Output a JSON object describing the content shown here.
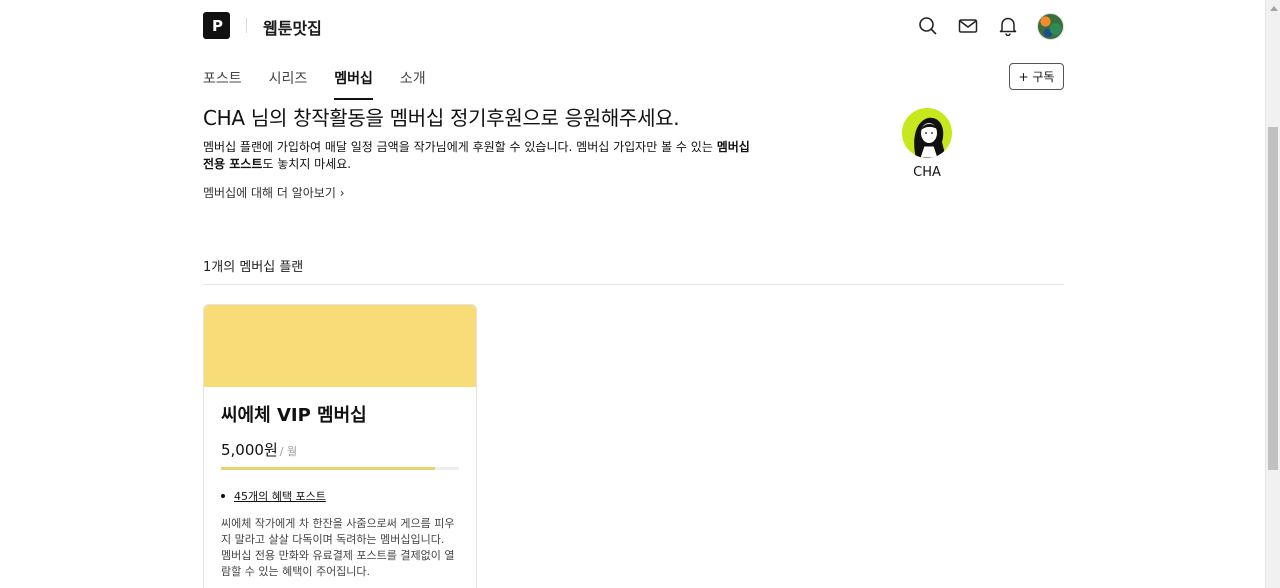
{
  "header": {
    "logo_text": "P",
    "blog_name": "웹툰맛집",
    "icons": [
      "search-icon",
      "mail-icon",
      "bell-icon",
      "avatar"
    ]
  },
  "tabs": [
    {
      "label": "포스트",
      "active": false
    },
    {
      "label": "시리즈",
      "active": false
    },
    {
      "label": "멤버십",
      "active": true
    },
    {
      "label": "소개",
      "active": false
    }
  ],
  "subscribe_label": "+ 구독",
  "intro": {
    "title": "CHA 님의 창작활동을 멤버십 정기후원으로 응원해주세요.",
    "desc_part1": "멤버십 플랜에 가입하여 매달 일정 금액을 작가님에게 후원할 수 있습니다. 멤버십 가입자만 볼 수 있는 ",
    "desc_bold": "멤버십 전용 포스트",
    "desc_part2": "도 놓치지 마세요.",
    "learn_more": "멤버십에 대해 더 알아보기 ›"
  },
  "creator": {
    "name": "CHA"
  },
  "plan_count": "1개의 멤버십 플랜",
  "plans": [
    {
      "title": "씨에체 VIP 멤버십",
      "price": "5,000원",
      "period": "/ 월",
      "progress_fraction": 0.9,
      "benefit": "45개의 혜택 포스트",
      "desc_1": "씨에체 작가에게 차 한잔을 사줌으로써 게으름 피우지 말라고 살살 다독이며 독려하는 멤버십입니다.",
      "desc_2": "멤버십 전용 만화와 유료결제 포스트를 결제없이 열람할 수 있는 혜택이 주어집니다."
    }
  ],
  "colors": {
    "card_banner": "#f7dc78",
    "creator_avatar_bg": "#c6e81c",
    "progress": "#e6d173"
  }
}
